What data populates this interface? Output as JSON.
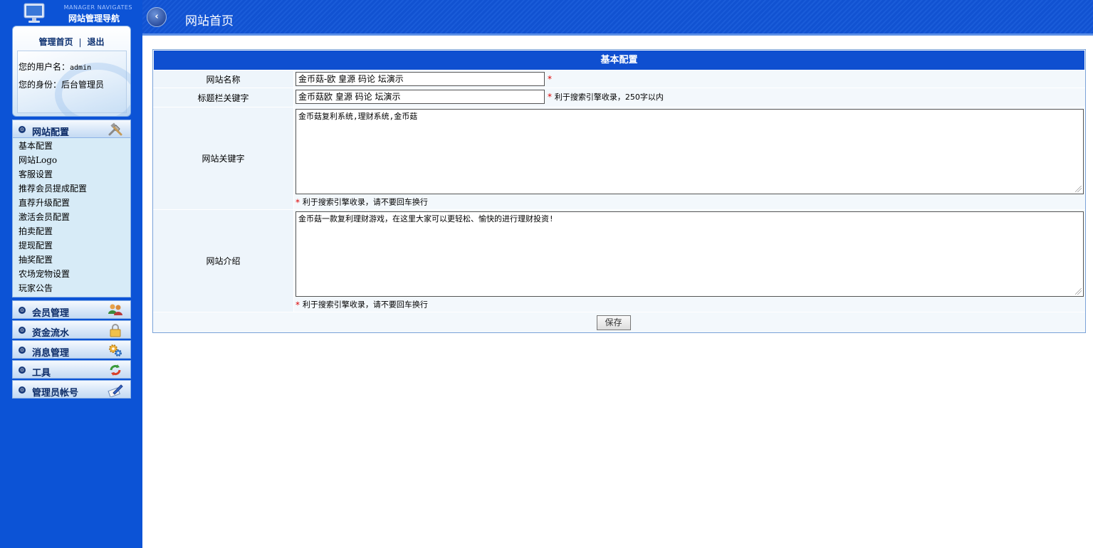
{
  "sidebar": {
    "logo_en": "MANAGER NAVIGATES",
    "logo_cn": "网站管理导航",
    "links": {
      "home": "管理首页",
      "separator": "|",
      "logout": "退出"
    },
    "user": {
      "username_label": "您的用户名：",
      "username": "admin",
      "role_label": "您的身份：",
      "role": "后台管理员"
    },
    "sections": [
      {
        "label": "网站配置",
        "icon": "tools-icon",
        "items": [
          "基本配置",
          "网站Logo",
          "客服设置",
          "推荐会员提成配置",
          "直荐升级配置",
          "激活会员配置",
          "拍卖配置",
          "提现配置",
          "抽奖配置",
          "农场宠物设置",
          "玩家公告"
        ]
      },
      {
        "label": "会员管理",
        "icon": "users-icon"
      },
      {
        "label": "资金流水",
        "icon": "lock-icon"
      },
      {
        "label": "消息管理",
        "icon": "gears-icon"
      },
      {
        "label": "工具",
        "icon": "refresh-icon"
      },
      {
        "label": "管理员帐号",
        "icon": "edit-icon"
      }
    ]
  },
  "header": {
    "back_glyph": "‹",
    "title": "网站首页"
  },
  "form": {
    "heading": "基本配置",
    "site_name": {
      "label": "网站名称",
      "value": "金币菇-欧 皇源 码论 坛演示",
      "required": "*"
    },
    "title_keywords": {
      "label": "标题栏关键字",
      "value": "金币菇欧 皇源 码论 坛演示",
      "required": "*",
      "hint": "利于搜索引擎收录，250字以内"
    },
    "site_keywords": {
      "label": "网站关键字",
      "value": "金币菇复利系统,理财系统,金币菇",
      "required": "*",
      "hint": "利于搜索引擎收录，请不要回车换行"
    },
    "site_intro": {
      "label": "网站介绍",
      "value": "金币菇一款复利理财游戏，在这里大家可以更轻松、愉快的进行理财投资!",
      "required": "*",
      "hint": "利于搜索引擎收录，请不要回车换行"
    },
    "save_label": "保存"
  },
  "colors": {
    "sidebar_bg": "#0c53d6",
    "header_bg": "#1152d1",
    "table_header": "#0f4fd0",
    "required": "#dd0000"
  }
}
